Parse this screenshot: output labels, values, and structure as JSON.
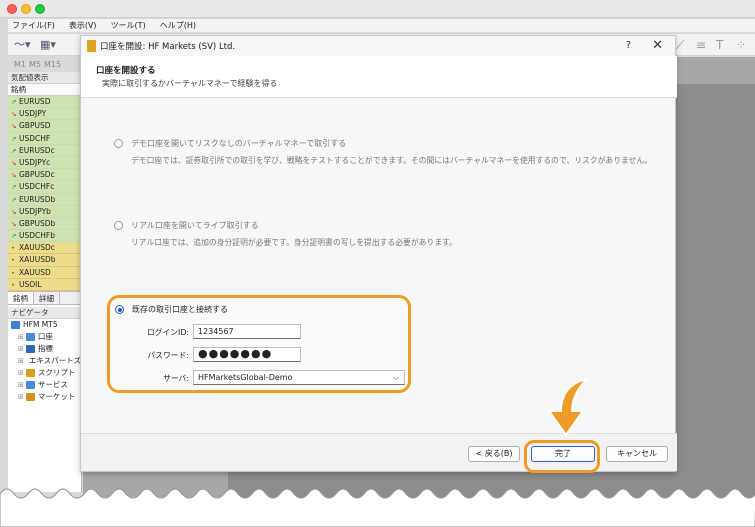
{
  "menu": [
    "ファイル(F)",
    "表示(V)",
    "ツール(T)",
    "ヘルプ(H)"
  ],
  "timeframes": [
    "M1",
    "M5",
    "M15"
  ],
  "market_watch": {
    "title": "気配値表示",
    "column_header": "銘柄",
    "symbols": [
      {
        "name": "EURUSD",
        "dir": "up",
        "group": "fx"
      },
      {
        "name": "USDJPY",
        "dir": "down",
        "group": "fx"
      },
      {
        "name": "GBPUSD",
        "dir": "down",
        "group": "fx"
      },
      {
        "name": "USDCHF",
        "dir": "up",
        "group": "fx"
      },
      {
        "name": "EURUSDc",
        "dir": "up",
        "group": "fx"
      },
      {
        "name": "USDJPYc",
        "dir": "down",
        "group": "fx"
      },
      {
        "name": "GBPUSDc",
        "dir": "down",
        "group": "fx"
      },
      {
        "name": "USDCHFc",
        "dir": "up",
        "group": "fx"
      },
      {
        "name": "EURUSDb",
        "dir": "up",
        "group": "fx"
      },
      {
        "name": "USDJPYb",
        "dir": "down",
        "group": "fx"
      },
      {
        "name": "GBPUSDb",
        "dir": "down",
        "group": "fx"
      },
      {
        "name": "USDCHFb",
        "dir": "up",
        "group": "fx"
      },
      {
        "name": "XAUUSDc",
        "dir": "dot",
        "group": "gold"
      },
      {
        "name": "XAUUSDb",
        "dir": "dot",
        "group": "gold"
      },
      {
        "name": "XAUUSD",
        "dir": "dot",
        "group": "gold"
      },
      {
        "name": "USOIL",
        "dir": "dot",
        "group": "gold"
      }
    ],
    "tabs": [
      "銘柄",
      "詳細"
    ]
  },
  "navigator": {
    "title": "ナビゲータ",
    "items": [
      {
        "label": "HFM MT5",
        "color": "#3a7fd0",
        "indent": 0
      },
      {
        "label": "口座",
        "color": "#4a8ad8",
        "indent": 1
      },
      {
        "label": "指標",
        "color": "#2c6ab8",
        "indent": 1
      },
      {
        "label": "エキスパートズ",
        "color": "#3a7fd0",
        "indent": 1
      },
      {
        "label": "スクリプト",
        "color": "#d8a020",
        "indent": 1
      },
      {
        "label": "サービス",
        "color": "#4a8ad8",
        "indent": 1
      },
      {
        "label": "マーケット",
        "color": "#d89020",
        "indent": 1
      }
    ]
  },
  "dialog": {
    "title": "口座を開設: HF Markets (SV) Ltd.",
    "help": "?",
    "close": "✕",
    "header_title": "口座を開設する",
    "header_subtitle": "実際に取引するかバーチャルマネーで経験を得る",
    "option_demo": {
      "label": "デモ口座を開いてリスクなしのバーチャルマネーで取引する",
      "desc": "デモ口座では、証券取引所での取引を学び、戦略をテストすることができます。その間にはバーチャルマネーを使用するので、リスクがありません。"
    },
    "option_real": {
      "label": "リアル口座を開いてライブ取引する",
      "desc": "リアル口座では、追加の身分証明が必要です。身分証明書の写しを提出する必要があります。"
    },
    "option_existing": {
      "label": "既存の取引口座と接続する",
      "login_label": "ログインID:",
      "login_value": "1234567",
      "password_label": "パスワード:",
      "password_value": "●●●●●●●",
      "server_label": "サーバ:",
      "server_value": "HFMarketsGlobal-Demo"
    },
    "buttons": {
      "back": "< 戻る(B)",
      "finish": "完了",
      "cancel": "キャンセル"
    }
  },
  "colors": {
    "accent_orange": "#ef9b28",
    "radio_blue": "#1e5fc4"
  }
}
